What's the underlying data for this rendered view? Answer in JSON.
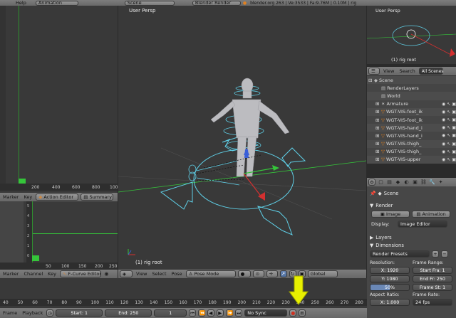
{
  "top_header": {
    "menu_help": "Help",
    "layout": "Animation",
    "scene": "Scene",
    "engine": "Blender Render",
    "info": "blender.org 263 | Ve:3533 | Fa:9.76M | 0.10M | rig"
  },
  "viewport": {
    "label": "User Persp",
    "object_label": "(1) rig root",
    "menus": [
      "View",
      "Select",
      "Pose"
    ],
    "mode": "Pose Mode",
    "orientation": "Global"
  },
  "mini_viewport": {
    "label": "User Persp",
    "object_label": "(1) rig root"
  },
  "outliner": {
    "menus": [
      "View",
      "Search"
    ],
    "filter": "All Scenes",
    "items": [
      {
        "label": "Scene",
        "indent": 0
      },
      {
        "label": "RenderLayers",
        "indent": 1
      },
      {
        "label": "World",
        "indent": 1
      },
      {
        "label": "Armature",
        "indent": 1
      },
      {
        "label": "WGT-VIS-foot_ik",
        "indent": 1
      },
      {
        "label": "WGT-VIS-foot_ik",
        "indent": 1
      },
      {
        "label": "WGT-VIS-hand_i",
        "indent": 1
      },
      {
        "label": "WGT-VIS-hand_i",
        "indent": 1
      },
      {
        "label": "WGT-VIS-thigh_",
        "indent": 1
      },
      {
        "label": "WGT-VIS-thigh_",
        "indent": 1
      },
      {
        "label": "WGT-VIS-upper",
        "indent": 1
      }
    ]
  },
  "properties": {
    "scene_label": "Scene",
    "render_section": "Render",
    "image_button": "Image",
    "animation_button": "Animation",
    "display_label": "Display:",
    "display_value": "Image Editor",
    "layers_section": "Layers",
    "dimensions_section": "Dimensions",
    "presets": "Render Presets",
    "resolution_label": "Resolution:",
    "res_x": "X: 1920",
    "res_y": "Y: 1080",
    "res_pct": "50%",
    "frame_range_label": "Frame Range:",
    "start_fra": "Start Fra: 1",
    "end_fr": "End Fr: 250",
    "frame_st": "Frame St: 1",
    "aspect_label": "Aspect Ratio:",
    "aspect_x": "X: 1.000",
    "frame_rate_label": "Frame Rate:",
    "fps": "24 fps"
  },
  "action_editor": {
    "menus": [
      "Marker",
      "Key"
    ],
    "mode": "Action Editor",
    "summary": "Summary",
    "ticks": [
      "200",
      "400",
      "600",
      "800",
      "1000"
    ]
  },
  "fcurve_editor": {
    "menus": [
      "Marker",
      "Channel",
      "Key"
    ],
    "mode": "F-Curve Editor",
    "ticks": [
      "50",
      "100",
      "150",
      "200",
      "250"
    ],
    "yticks": [
      "5",
      "4",
      "3",
      "2",
      "1",
      "0"
    ]
  },
  "timeline": {
    "ticks": [
      "40",
      "50",
      "60",
      "70",
      "80",
      "90",
      "100",
      "110",
      "120",
      "130",
      "140",
      "150",
      "160",
      "170",
      "180",
      "190",
      "200",
      "210",
      "220",
      "230",
      "240",
      "250",
      "260",
      "270",
      "280"
    ],
    "menus": [
      "Frame",
      "Playback"
    ],
    "start": "Start: 1",
    "end": "End: 250",
    "current": "1",
    "sync": "No Sync"
  },
  "colors": {
    "arrow_highlight": "#e8f000",
    "record_button": "#d03020",
    "widget_cyan": "#5fd0e8",
    "grid_green": "#35c53a"
  }
}
